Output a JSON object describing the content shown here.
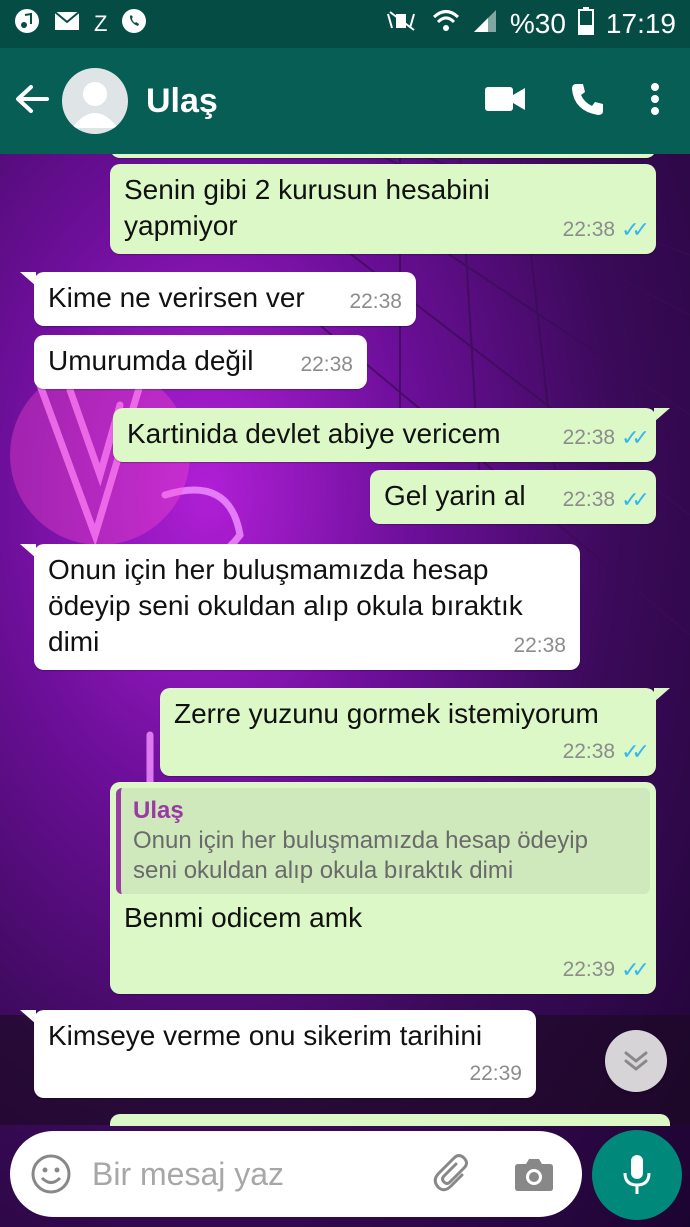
{
  "statusbar": {
    "left_icons": [
      "music-icon",
      "mail-icon",
      "z-icon",
      "whatsapp-icon"
    ],
    "z_label": "Z",
    "battery": "%30",
    "time": "17:19"
  },
  "appbar": {
    "contact_name": "Ulaş"
  },
  "messages": [
    {
      "dir": "out",
      "text": "Senin gibi 2 kurusun hesabini yapmiyor",
      "time": "22:38"
    },
    {
      "dir": "in",
      "text": "Kime ne verirsen ver",
      "time": "22:38"
    },
    {
      "dir": "in",
      "text": "Umurumda değil",
      "time": "22:38"
    },
    {
      "dir": "out",
      "text": "Kartinida devlet abiye vericem",
      "time": "22:38"
    },
    {
      "dir": "out",
      "text": "Gel yarin al",
      "time": "22:38"
    },
    {
      "dir": "in",
      "text": "Onun için her buluşmamızda hesap ödeyip seni okuldan alıp okula bıraktık dimi",
      "time": "22:38"
    },
    {
      "dir": "out",
      "text": "Zerre yuzunu gormek istemiyorum",
      "time": "22:38"
    },
    {
      "dir": "out",
      "text": "Benmi odicem amk",
      "time": "22:39",
      "quote_name": "Ulaş",
      "quote_text": "Onun için her buluşmamızda hesap ödeyip seni okuldan alıp okula bıraktık dimi"
    },
    {
      "dir": "in",
      "text": "Kimseye verme onu sikerim tarihini",
      "time": "22:39"
    }
  ],
  "composer": {
    "placeholder": "Bir mesaj yaz"
  },
  "colors": {
    "header": "#075e54",
    "statusbar": "#054d44",
    "outgoing_bubble": "#dcf8c6",
    "incoming_bubble": "#ffffff",
    "read_ticks": "#34b7f1",
    "mic_button": "#00897b",
    "quote_accent": "#9a3aa3"
  }
}
